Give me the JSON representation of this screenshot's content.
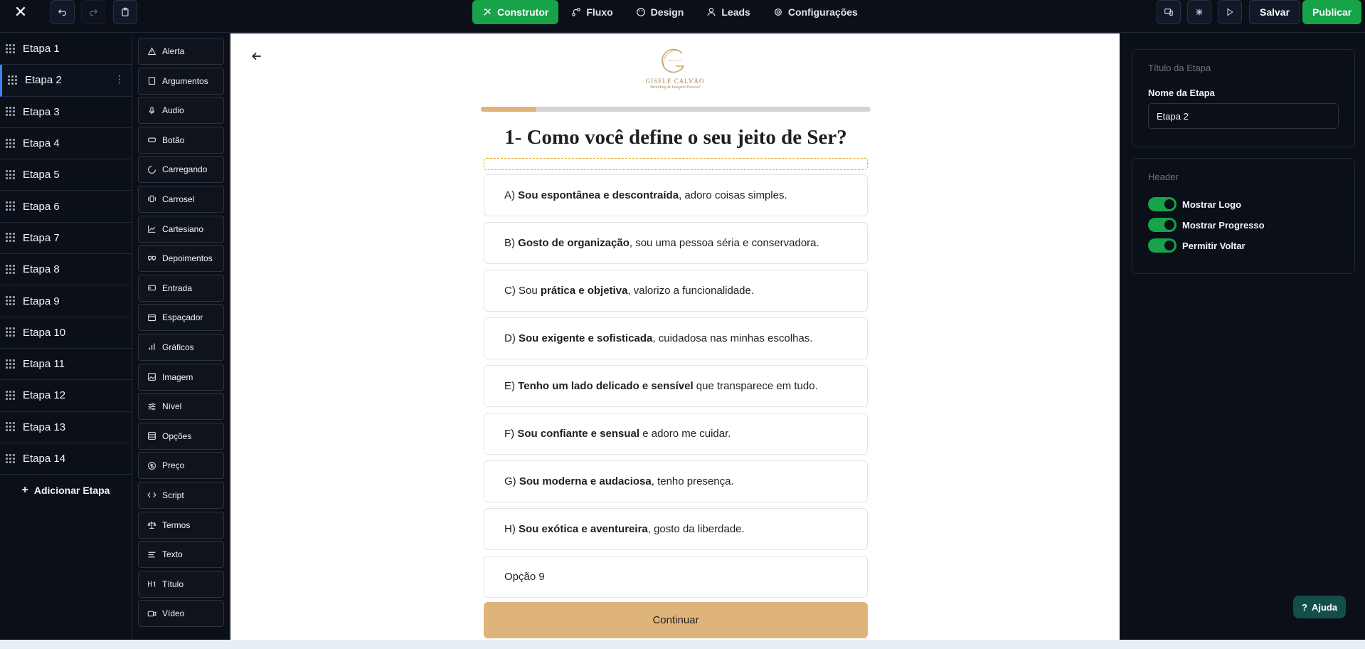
{
  "toolbar": {
    "close_icon": "close-icon",
    "undo_icon": "undo-icon",
    "redo_icon": "redo-icon",
    "clipboard_icon": "clipboard-icon",
    "tabs": [
      {
        "label": "Construtor",
        "icon": "builder-icon",
        "active": true
      },
      {
        "label": "Fluxo",
        "icon": "flow-icon",
        "active": false
      },
      {
        "label": "Design",
        "icon": "palette-icon",
        "active": false
      },
      {
        "label": "Leads",
        "icon": "user-icon",
        "active": false
      },
      {
        "label": "Configurações",
        "icon": "gear-icon",
        "active": false
      }
    ],
    "save_label": "Salvar",
    "publish_label": "Publicar",
    "accent": "#16a34a"
  },
  "steps": {
    "items": [
      {
        "label": "Etapa 1"
      },
      {
        "label": "Etapa 2",
        "active": true
      },
      {
        "label": "Etapa 3"
      },
      {
        "label": "Etapa 4"
      },
      {
        "label": "Etapa 5"
      },
      {
        "label": "Etapa 6"
      },
      {
        "label": "Etapa 7"
      },
      {
        "label": "Etapa 8"
      },
      {
        "label": "Etapa 9"
      },
      {
        "label": "Etapa 10"
      },
      {
        "label": "Etapa 11"
      },
      {
        "label": "Etapa 12"
      },
      {
        "label": "Etapa 13"
      },
      {
        "label": "Etapa 14"
      }
    ],
    "add_label": "Adicionar Etapa"
  },
  "components": [
    {
      "label": "Alerta",
      "icon": "alert-triangle-icon"
    },
    {
      "label": "Argumentos",
      "icon": "book-icon"
    },
    {
      "label": "Audio",
      "icon": "mic-icon"
    },
    {
      "label": "Botão",
      "icon": "button-icon"
    },
    {
      "label": "Carregando",
      "icon": "loader-icon"
    },
    {
      "label": "Carrosel",
      "icon": "carousel-icon"
    },
    {
      "label": "Cartesiano",
      "icon": "area-chart-icon"
    },
    {
      "label": "Depoimentos",
      "icon": "quote-icon"
    },
    {
      "label": "Entrada",
      "icon": "input-icon"
    },
    {
      "label": "Espaçador",
      "icon": "spacer-icon"
    },
    {
      "label": "Gráficos",
      "icon": "bar-chart-icon"
    },
    {
      "label": "Imagem",
      "icon": "image-icon"
    },
    {
      "label": "Nível",
      "icon": "sliders-icon"
    },
    {
      "label": "Opções",
      "icon": "list-icon"
    },
    {
      "label": "Preço",
      "icon": "dollar-icon"
    },
    {
      "label": "Script",
      "icon": "code-icon"
    },
    {
      "label": "Termos",
      "icon": "scale-icon"
    },
    {
      "label": "Texto",
      "icon": "text-icon"
    },
    {
      "label": "Título",
      "icon": "heading-icon"
    },
    {
      "label": "Vídeo",
      "icon": "video-icon"
    }
  ],
  "canvas": {
    "logo_name": "GISELE CALVÃO",
    "logo_tagline": "Branding & Imagem Pessoal",
    "progress": 0.143,
    "progress_color": "#dfb47b",
    "question": "1- Como você define o seu jeito de Ser?",
    "options": [
      {
        "prefix": "A) ",
        "bold": "Sou espontânea e descontraída",
        "rest": ", adoro coisas simples."
      },
      {
        "prefix": "B) ",
        "bold": "Gosto de organização",
        "rest": ", sou uma pessoa séria e conservadora."
      },
      {
        "prefix": "C) Sou ",
        "bold": "prática e objetiva",
        "rest": ", valorizo a funcionalidade."
      },
      {
        "prefix": "D) ",
        "bold": "Sou exigente e sofisticada",
        "rest": ", cuidadosa nas minhas escolhas."
      },
      {
        "prefix": "E) ",
        "bold": "Tenho um lado delicado e sensível",
        "rest": " que transparece em tudo."
      },
      {
        "prefix": "F) ",
        "bold": "Sou confiante e sensual",
        "rest": " e adoro me cuidar."
      },
      {
        "prefix": "G) ",
        "bold": "Sou moderna e audaciosa",
        "rest": ", tenho presença."
      },
      {
        "prefix": "H) ",
        "bold": "Sou exótica e aventureira",
        "rest": ", gosto da liberdade."
      },
      {
        "prefix": "Opção 9",
        "bold": "",
        "rest": ""
      }
    ],
    "cta_label": "Continuar"
  },
  "properties": {
    "step_card": {
      "title": "Título da Etapa",
      "field_label": "Nome da Etapa",
      "field_value": "Etapa 2"
    },
    "header_card": {
      "title": "Header",
      "toggles": [
        {
          "label": "Mostrar Logo",
          "on": true
        },
        {
          "label": "Mostrar Progresso",
          "on": true
        },
        {
          "label": "Permitir Voltar",
          "on": true
        }
      ]
    }
  },
  "help": {
    "label": "Ajuda"
  }
}
